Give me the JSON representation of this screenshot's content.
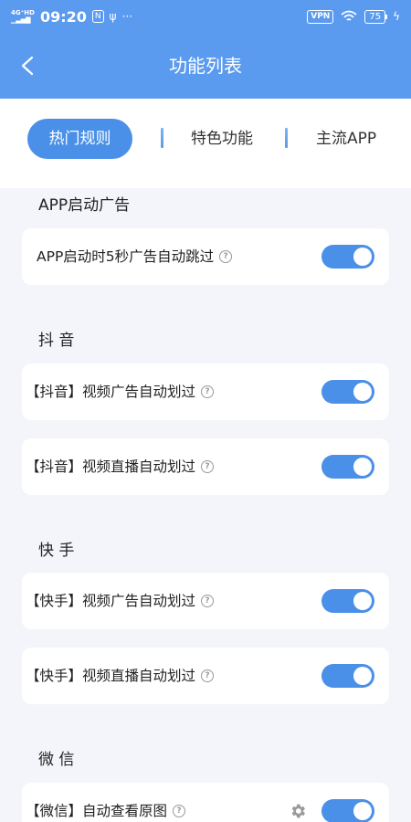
{
  "status_bar": {
    "network_top": "4G⁺HD",
    "network_bottom": "▁▃▅▇",
    "time": "09:20",
    "extra_icon": "N",
    "usb": "ψ",
    "more": "···",
    "vpn": "VPN",
    "wifi": "wifi-icon",
    "battery": "75",
    "charging": "ϟ"
  },
  "header": {
    "title": "功能列表"
  },
  "tabs": [
    {
      "label": "热门规则",
      "active": true
    },
    {
      "label": "特色功能",
      "active": false
    },
    {
      "label": "主流APP",
      "active": false
    }
  ],
  "sections": [
    {
      "title": "APP启动广告",
      "items": [
        {
          "label": "APP启动时5秒广告自动跳过",
          "enabled": true
        }
      ]
    },
    {
      "title": "抖  音",
      "items": [
        {
          "label": "【抖音】视频广告自动划过",
          "enabled": true
        },
        {
          "label": "【抖音】视频直播自动划过",
          "enabled": true
        }
      ]
    },
    {
      "title": "快  手",
      "items": [
        {
          "label": "【快手】视频广告自动划过",
          "enabled": true
        },
        {
          "label": "【快手】视频直播自动划过",
          "enabled": true
        }
      ]
    },
    {
      "title": "微  信",
      "items": [
        {
          "label": "【微信】自动查看原图",
          "enabled": true,
          "settings_icon": "gear-icon"
        }
      ]
    }
  ],
  "help_glyph": "?",
  "colors": {
    "accent": "#4a90e8",
    "header": "#5b9bef",
    "background": "#f4f5fa"
  }
}
